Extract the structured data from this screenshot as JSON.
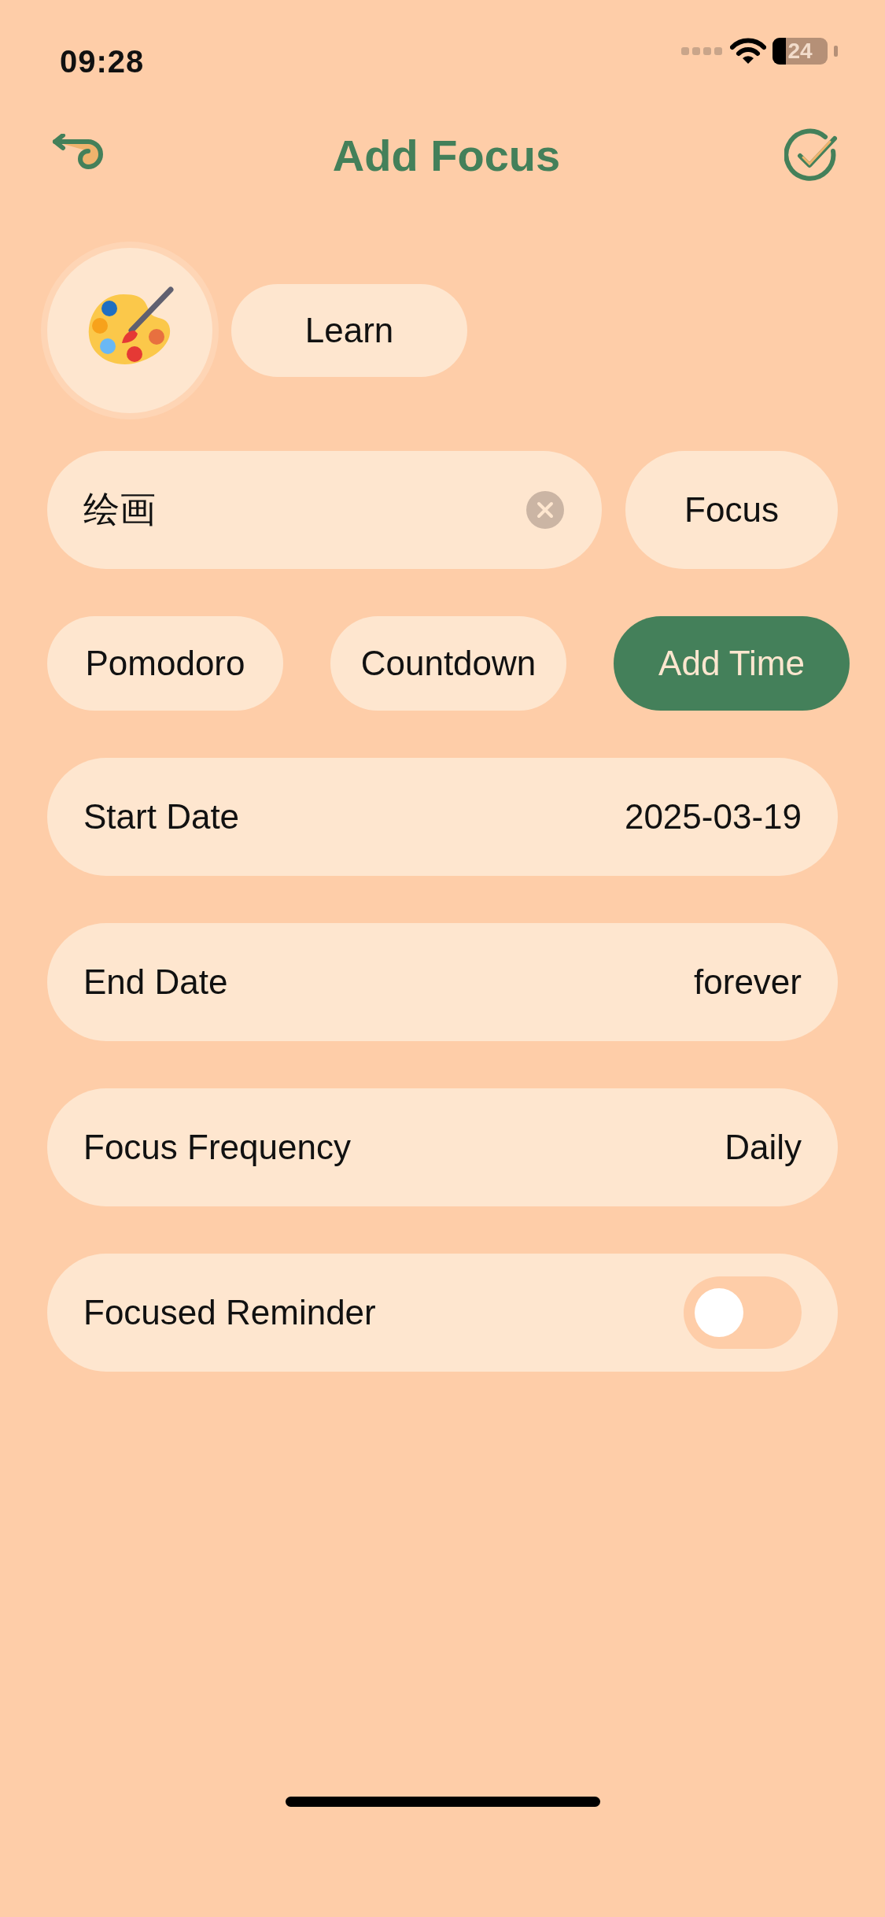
{
  "status_bar": {
    "time": "09:28",
    "battery": "24"
  },
  "header": {
    "title": "Add Focus"
  },
  "category": {
    "label": "Learn"
  },
  "name_field": {
    "value": "绘画"
  },
  "type_button": {
    "label": "Focus"
  },
  "modes": [
    {
      "label": "Pomodoro",
      "selected": false
    },
    {
      "label": "Countdown",
      "selected": false
    },
    {
      "label": "Add Time",
      "selected": true
    }
  ],
  "settings": [
    {
      "kind": "value",
      "label": "Start Date",
      "value": "2025-03-19"
    },
    {
      "kind": "value",
      "label": "End Date",
      "value": "forever"
    },
    {
      "kind": "value",
      "label": "Focus Frequency",
      "value": "Daily"
    },
    {
      "kind": "toggle",
      "label": "Focused Reminder",
      "on": false
    }
  ]
}
